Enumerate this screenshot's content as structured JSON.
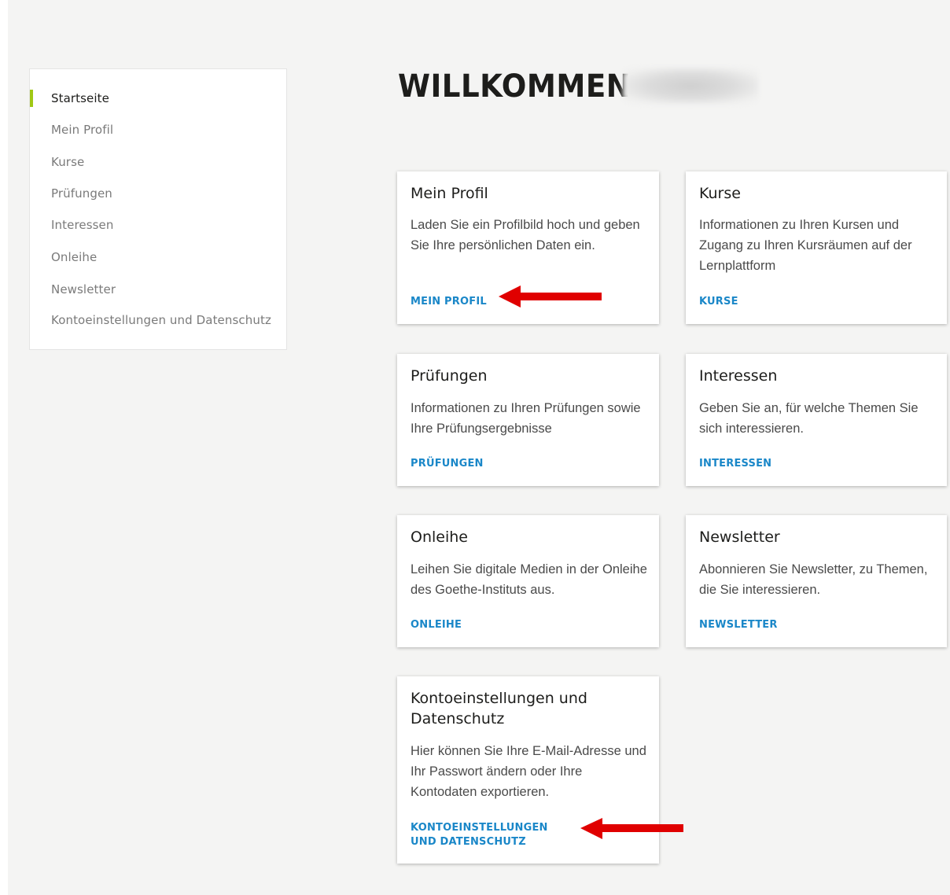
{
  "sidebar": {
    "items": [
      {
        "label": "Startseite",
        "active": true
      },
      {
        "label": "Mein Profil"
      },
      {
        "label": "Kurse"
      },
      {
        "label": "Prüfungen"
      },
      {
        "label": "Interessen"
      },
      {
        "label": "Onleihe"
      },
      {
        "label": "Newsletter"
      },
      {
        "label": "Kontoeinstellungen und Datenschutz"
      }
    ]
  },
  "header": {
    "title": "WILLKOMMEN"
  },
  "cards": [
    {
      "title": "Mein Profil",
      "desc": "Laden Sie ein Profilbild hoch und geben Sie Ihre persönlichen Daten ein.",
      "link": "MEIN PROFIL"
    },
    {
      "title": "Kurse",
      "desc": "Informationen zu Ihren Kursen und Zugang zu Ihren Kursräumen auf der Lernplattform",
      "link": "KURSE"
    },
    {
      "title": "Prüfungen",
      "desc": "Informationen zu Ihren Prüfungen sowie Ihre Prüfungsergebnisse",
      "link": "PRÜFUNGEN"
    },
    {
      "title": "Interessen",
      "desc": "Geben Sie an, für welche Themen Sie sich interessieren.",
      "link": "INTERESSEN"
    },
    {
      "title": "Onleihe",
      "desc": "Leihen Sie digitale Medien in der Onleihe des Goethe-Instituts aus.",
      "link": "ONLEIHE"
    },
    {
      "title": "Newsletter",
      "desc": "Abonnieren Sie Newsletter, zu Themen, die Sie interessieren.",
      "link": "NEWSLETTER"
    },
    {
      "title": "Kontoeinstellungen und Datenschutz",
      "desc": "Hier können Sie Ihre E-Mail-Adresse und Ihr Passwort ändern oder Ihre Kontodaten exportieren.",
      "link": "KONTOEINSTELLUNGEN UND DATENSCHUTZ"
    }
  ],
  "colors": {
    "accent_green": "#a0c814",
    "link_blue": "#1a87c8",
    "annotation_red": "#e00000"
  },
  "icons": {
    "annotation": "red-left-arrow"
  }
}
